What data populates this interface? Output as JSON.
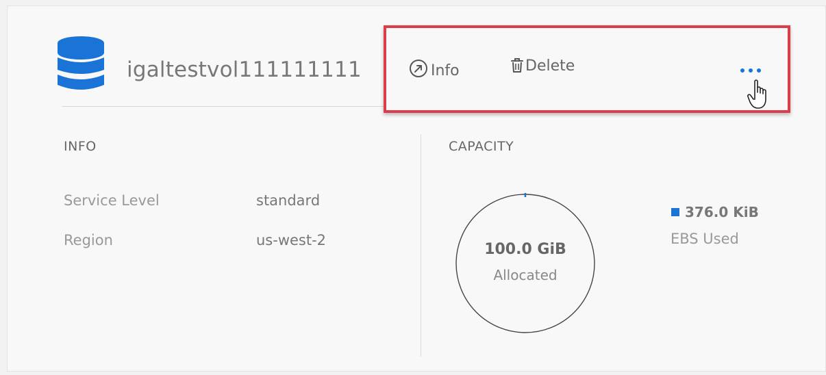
{
  "volume": {
    "name": "igaltestvol111111111"
  },
  "actions": {
    "info_label": "Info",
    "delete_label": "Delete"
  },
  "info": {
    "title": "INFO",
    "rows": [
      {
        "label": "Service Level",
        "value": "standard"
      },
      {
        "label": "Region",
        "value": "us-west-2"
      }
    ]
  },
  "capacity": {
    "title": "CAPACITY",
    "allocated_value": "100.0 GiB",
    "allocated_label": "Allocated",
    "used_value": "376.0 KiB",
    "used_label": "EBS Used",
    "used_fraction": 3.5e-06
  },
  "colors": {
    "accent": "#1a73d6",
    "highlight_border": "#dc3d4a"
  },
  "icons": {
    "volume": "database-icon",
    "info": "arrow-circle-icon",
    "delete": "trash-icon",
    "more": "more-dots-icon",
    "cursor": "hand-pointer-icon"
  }
}
